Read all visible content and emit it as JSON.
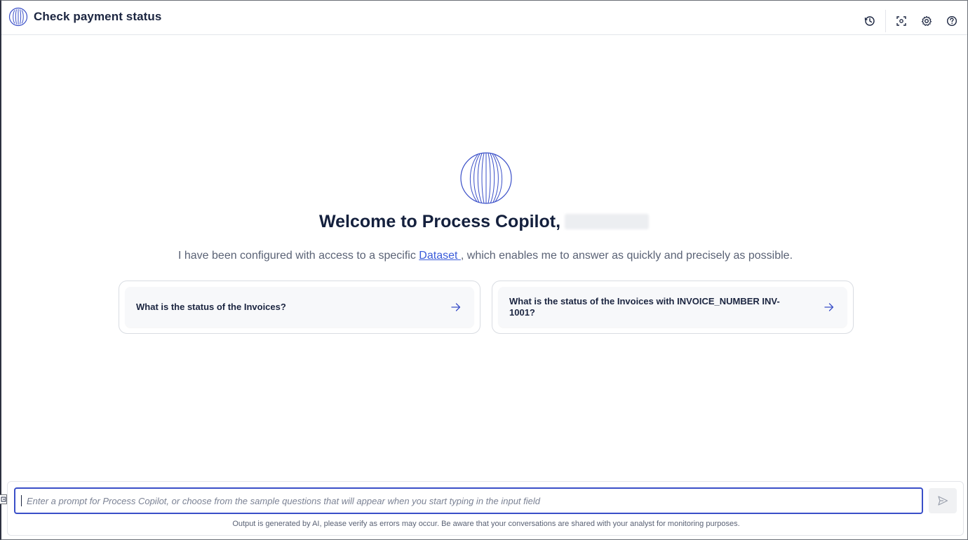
{
  "header": {
    "title": "Check payment status",
    "icons": [
      "history-icon",
      "screen-capture-icon",
      "gear-icon",
      "help-icon"
    ]
  },
  "welcome": {
    "heading": "Welcome to Process Copilot,",
    "intro_before": "I have been configured with access to a specific ",
    "intro_link": "Dataset ",
    "intro_after": ", which enables me to answer as quickly and precisely as possible."
  },
  "suggestions": [
    {
      "text": "What is the status of the Invoices?"
    },
    {
      "text": "What is the status of the Invoices with INVOICE_NUMBER INV-1001?"
    }
  ],
  "prompt": {
    "placeholder": "Enter a prompt for Process Copilot, or choose from the sample questions that will appear when you start typing in the input field",
    "value": ""
  },
  "disclaimer": "Output is generated by AI, please verify as errors may occur. Be aware that your conversations are shared with your analyst for monitoring purposes.",
  "colors": {
    "accent": "#3a4fc8",
    "title": "#1b2540",
    "muted": "#5a6275",
    "link": "#3a5bd9"
  }
}
